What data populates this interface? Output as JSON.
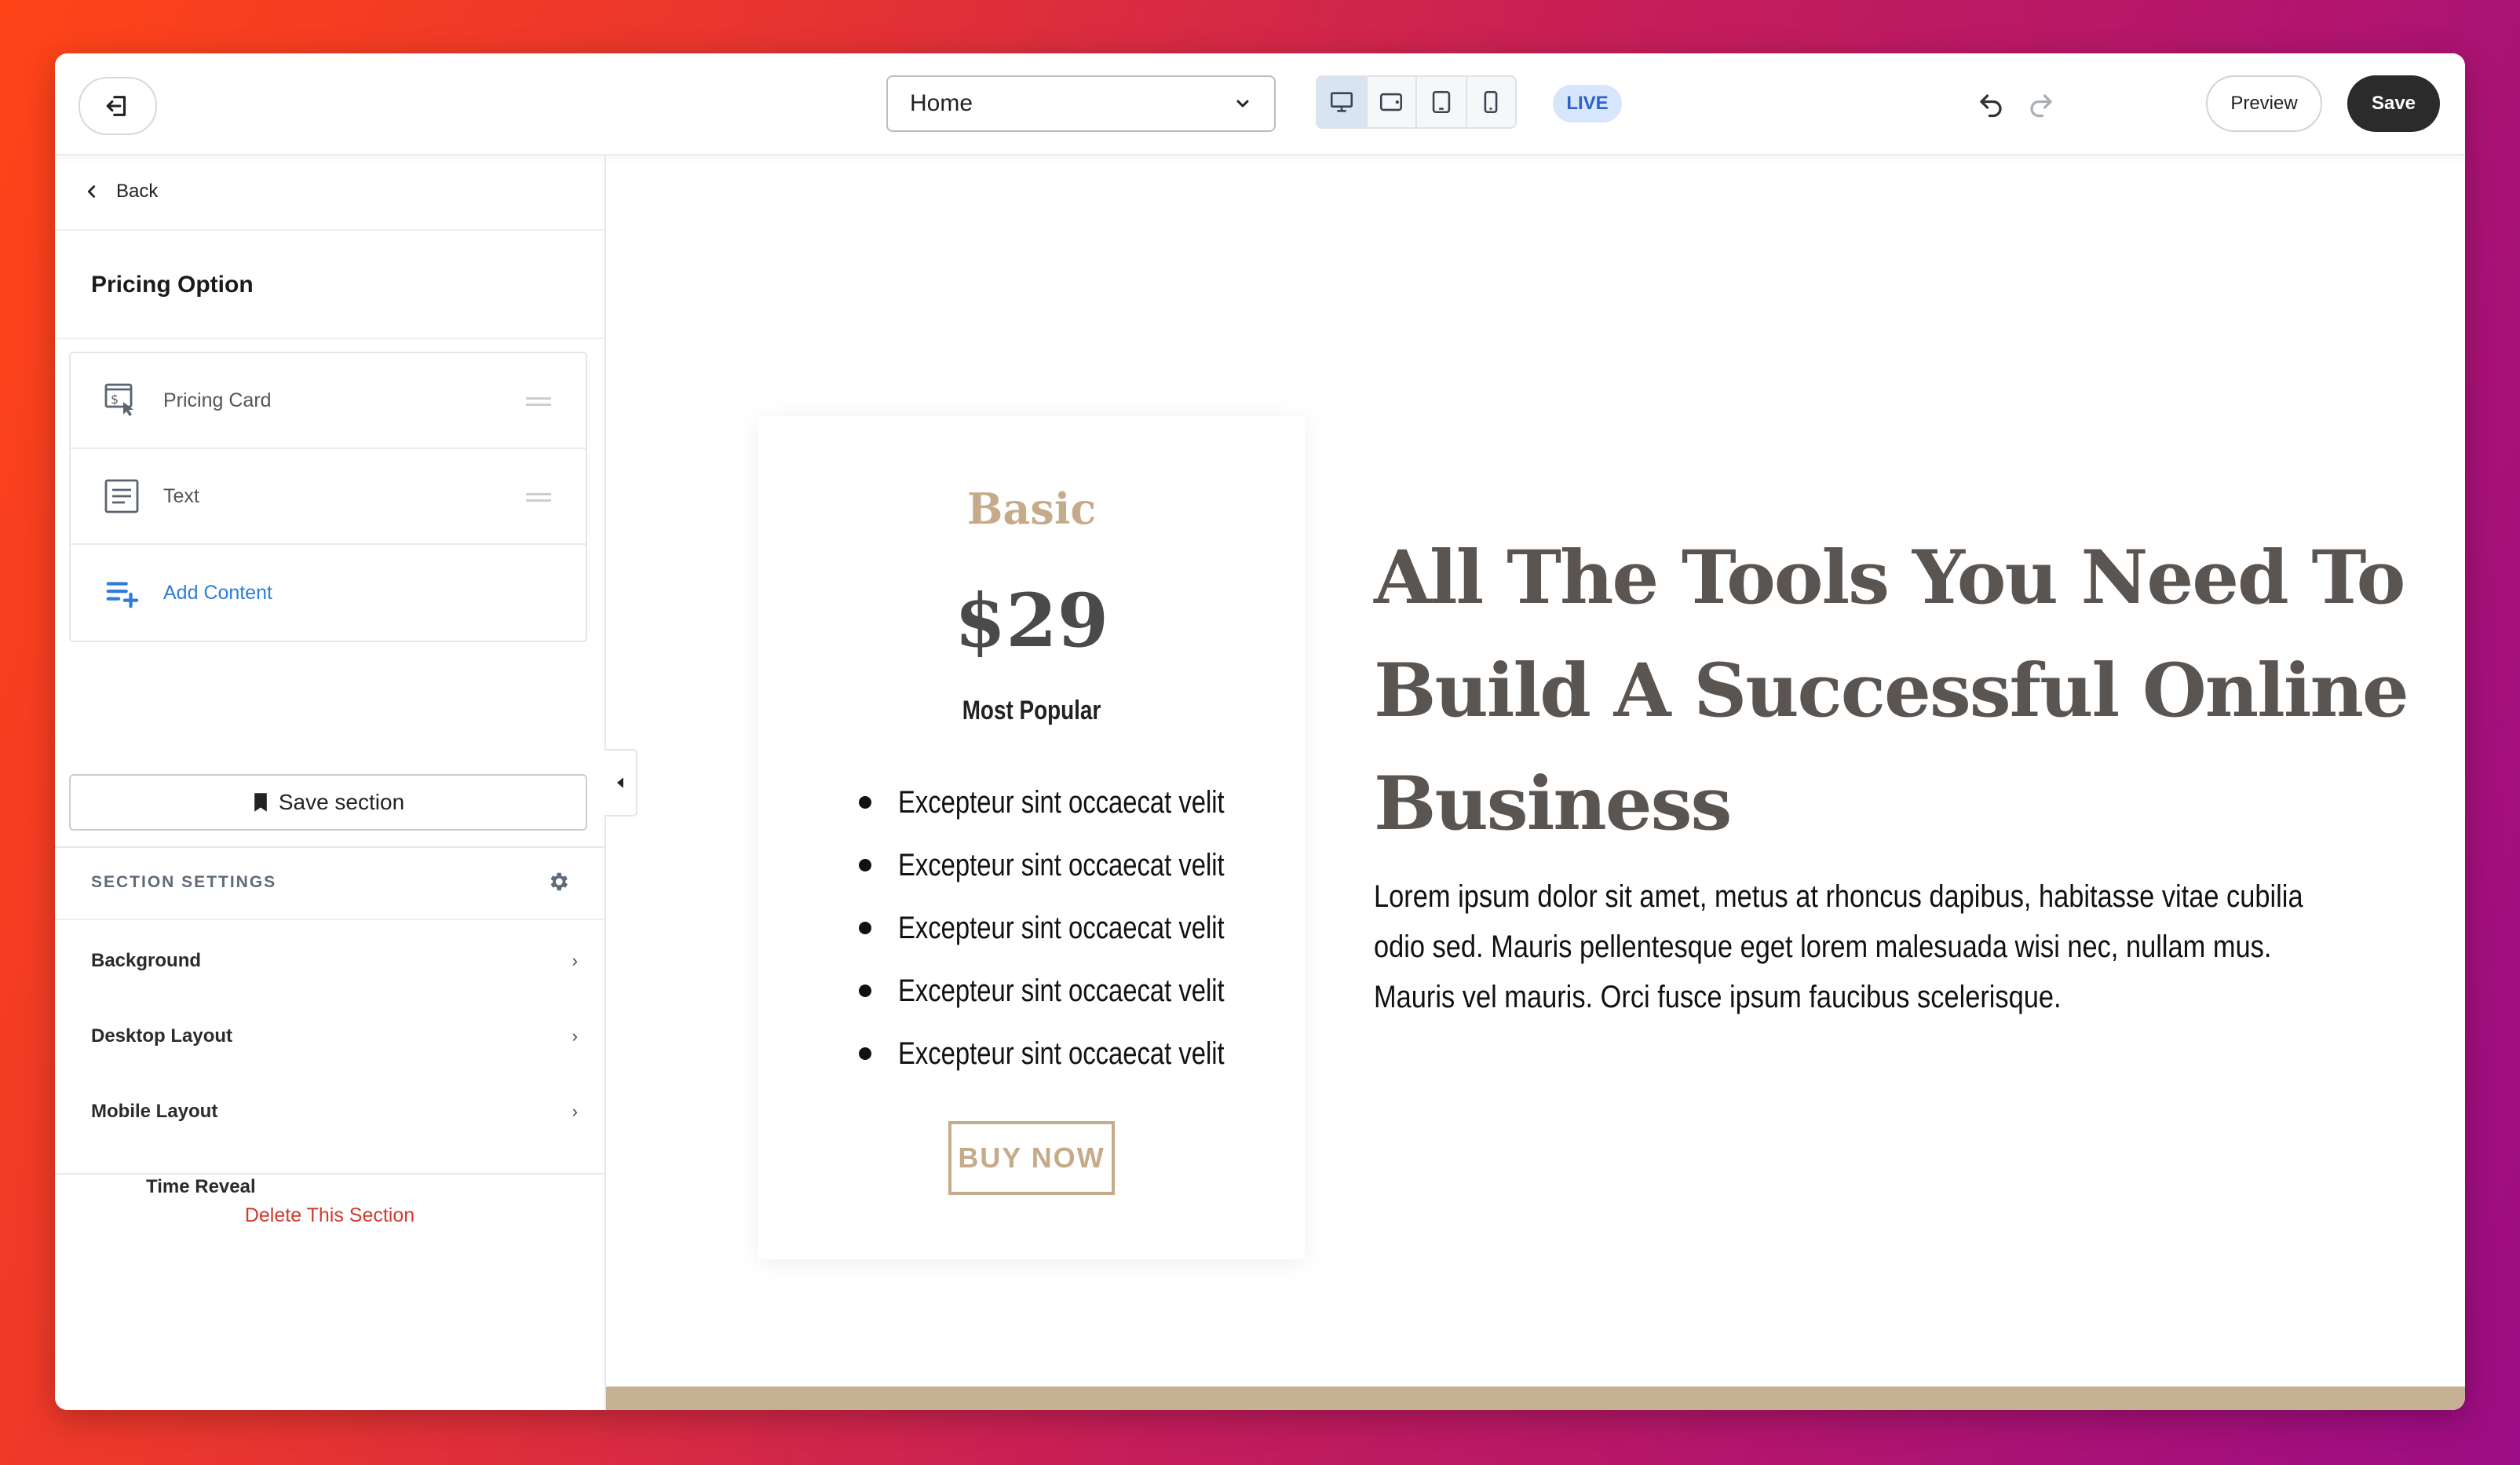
{
  "topbar": {
    "page_select": {
      "value": "Home"
    },
    "live_badge": "LIVE",
    "preview_label": "Preview",
    "save_label": "Save"
  },
  "sidebar": {
    "back_label": "Back",
    "title": "Pricing Option",
    "content_items": [
      {
        "label": "Pricing Card",
        "icon": "pricing-card-icon"
      },
      {
        "label": "Text",
        "icon": "text-block-icon"
      },
      {
        "label": "Add Content",
        "icon": "add-content-icon"
      }
    ],
    "save_section_label": "Save section",
    "section_settings_heading": "SECTION SETTINGS",
    "settings_rows": [
      "Background",
      "Desktop Layout",
      "Mobile Layout",
      "Time Reveal"
    ],
    "delete_label": "Delete This Section"
  },
  "canvas": {
    "card": {
      "tier": "Basic",
      "price": "$29",
      "tag": "Most Popular",
      "features": [
        "Excepteur sint occaecat velit",
        "Excepteur sint occaecat velit",
        "Excepteur sint occaecat velit",
        "Excepteur sint occaecat velit",
        "Excepteur sint occaecat velit"
      ],
      "button_label": "BUY NOW"
    },
    "headline": "All The Tools You Need To Build A Successful Online Business",
    "body": "Lorem ipsum dolor sit amet, metus at rhoncus dapibus, habitasse vitae cubilia odio sed. Mauris pellentesque eget lorem malesuada wisi nec, nullam mus. Mauris vel mauris. Orci fusce ipsum faucibus scelerisque."
  },
  "colors": {
    "accent_tan": "#c6ab8b",
    "headline": "#5b5552",
    "link_blue": "#2f7dd8",
    "danger_red": "#d13a2f",
    "live_badge_bg": "#d8e6fb"
  }
}
